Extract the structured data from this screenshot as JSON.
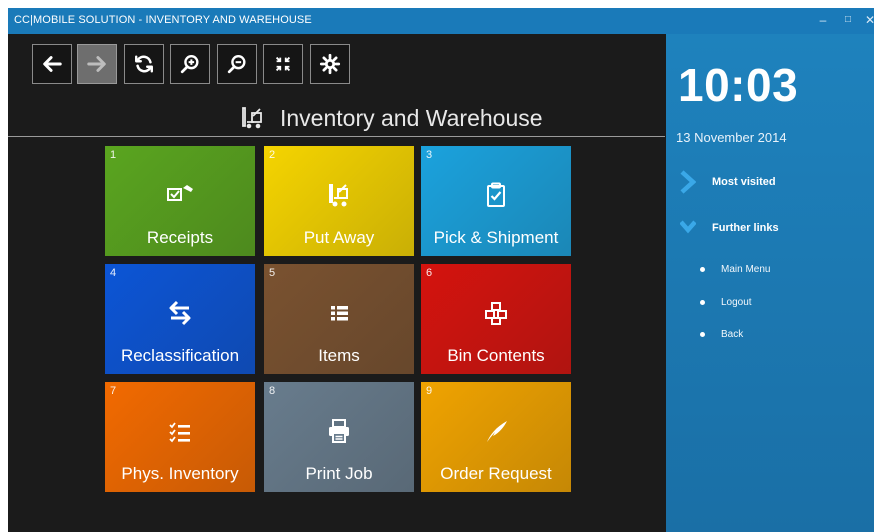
{
  "window": {
    "title": "CC|MOBILE SOLUTION - INVENTORY AND WAREHOUSE",
    "minimize": "–",
    "maximize": "□",
    "close": "✕"
  },
  "toolbar": [
    {
      "name": "back-button",
      "icon": "arrow-left-icon",
      "enabled": true
    },
    {
      "name": "forward-button",
      "icon": "arrow-right-icon",
      "enabled": false
    },
    {
      "name": "refresh-button",
      "icon": "refresh-icon",
      "enabled": true
    },
    {
      "name": "zoom-in-button",
      "icon": "zoom-in-icon",
      "enabled": true
    },
    {
      "name": "zoom-out-button",
      "icon": "zoom-out-icon",
      "enabled": true
    },
    {
      "name": "collapse-button",
      "icon": "compress-icon",
      "enabled": true
    },
    {
      "name": "settings-button",
      "icon": "gear-icon",
      "enabled": true
    }
  ],
  "page": {
    "title": "Inventory and Warehouse",
    "icon": "forklift-icon"
  },
  "tiles": [
    {
      "number": "1",
      "label": "Receipts",
      "icon": "receipt-check-icon",
      "color": "#5aa51f"
    },
    {
      "number": "2",
      "label": "Put Away",
      "icon": "forklift-icon",
      "color": "#f5d400"
    },
    {
      "number": "3",
      "label": "Pick & Shipment",
      "icon": "clipboard-check-icon",
      "color": "#1ba2dd"
    },
    {
      "number": "4",
      "label": "Reclassification",
      "icon": "exchange-arrows-icon",
      "color": "#0c55d6"
    },
    {
      "number": "5",
      "label": "Items",
      "icon": "list-icon",
      "color": "#7a5230"
    },
    {
      "number": "6",
      "label": "Bin Contents",
      "icon": "boxes-icon",
      "color": "#d5130e"
    },
    {
      "number": "7",
      "label": "Phys. Inventory",
      "icon": "checklist-icon",
      "color": "#f26a00"
    },
    {
      "number": "8",
      "label": "Print Job",
      "icon": "printer-icon",
      "color": "#687c8d"
    },
    {
      "number": "9",
      "label": "Order Request",
      "icon": "quill-icon",
      "color": "#f0a300"
    }
  ],
  "sidebar": {
    "time": "10:03",
    "date": "13 November 2014",
    "most_visited": "Most visited",
    "further_links": "Further links",
    "links": [
      "Main Menu",
      "Logout",
      "Back"
    ]
  }
}
